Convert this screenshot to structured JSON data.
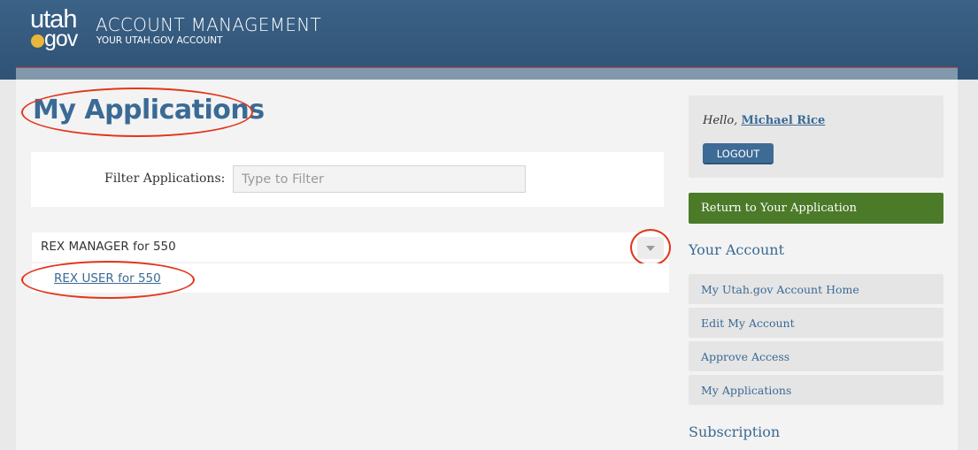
{
  "header": {
    "logo_top": "utah",
    "logo_bottom": "gov",
    "title": "ACCOUNT MANAGEMENT",
    "subtitle": "YOUR UTAH.GOV ACCOUNT"
  },
  "main": {
    "page_title": "My Applications",
    "filter": {
      "label": "Filter Applications:",
      "placeholder": "Type to Filter",
      "value": ""
    },
    "applications": [
      {
        "label": "REX MANAGER for 550",
        "expanded": true,
        "children": [
          {
            "label": "REX USER for 550"
          }
        ]
      }
    ]
  },
  "sidebar": {
    "greeting": "Hello,",
    "user_name": "Michael Rice",
    "logout_label": "LOGOUT",
    "return_label": "Return to Your Application",
    "account_heading": "Your Account",
    "account_links": [
      {
        "label": "My Utah.gov Account Home"
      },
      {
        "label": "Edit My Account"
      },
      {
        "label": "Approve Access"
      },
      {
        "label": "My Applications"
      }
    ],
    "subscription_heading": "Subscription"
  },
  "colors": {
    "header_blue": "#345a7e",
    "link_blue": "#3a6a95",
    "return_green": "#4b7a29",
    "logo_dot": "#e9b73a",
    "annotation_red": "#e2361c"
  }
}
